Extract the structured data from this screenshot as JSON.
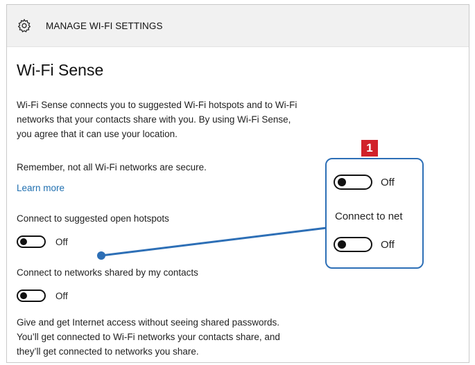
{
  "header": {
    "title": "MANAGE WI-FI SETTINGS",
    "icon": "gear-icon"
  },
  "main": {
    "heading": "Wi-Fi Sense",
    "intro_lines": [
      "Wi-Fi Sense connects you to suggested Wi-Fi hotspots and to Wi-Fi",
      "networks that your contacts share with you. By using Wi-Fi Sense,",
      "you agree that it can use your location."
    ],
    "warning": "Remember, not all Wi-Fi networks are secure.",
    "learn_more": "Learn more",
    "settings": [
      {
        "label": "Connect to suggested open hotspots",
        "state": "Off"
      },
      {
        "label": "Connect to networks shared by my contacts",
        "state": "Off"
      }
    ],
    "footer_lines": [
      "Give and get Internet access without seeing shared passwords.",
      "You’ll get connected to Wi-Fi networks your contacts share, and",
      "they’ll get connected to networks you share."
    ]
  },
  "callout": {
    "badge": "1",
    "toggle1_state": "Off",
    "partial_label": "Connect to net",
    "toggle2_state": "Off"
  },
  "colors": {
    "accent": "#2d6fb6",
    "badge": "#d1222a",
    "link": "#1f6fb0",
    "header_bg": "#f1f1f1"
  }
}
